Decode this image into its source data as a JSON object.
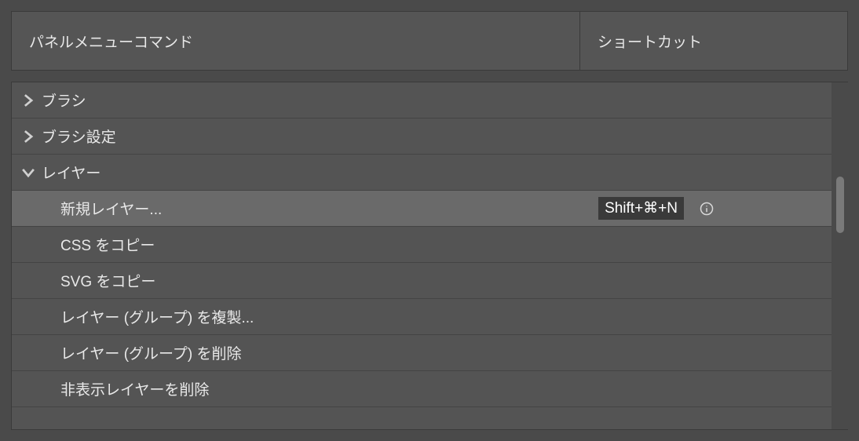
{
  "header": {
    "left_label": "パネルメニューコマンド",
    "right_label": "ショートカット"
  },
  "groups": [
    {
      "label": "ブラシ",
      "expanded": false,
      "children": []
    },
    {
      "label": "ブラシ設定",
      "expanded": false,
      "children": []
    },
    {
      "label": "レイヤー",
      "expanded": true,
      "children": [
        {
          "label": "新規レイヤー...",
          "shortcut": "Shift+⌘+N",
          "selected": true,
          "info": true
        },
        {
          "label": "CSS をコピー",
          "shortcut": "",
          "selected": false,
          "info": false
        },
        {
          "label": "SVG をコピー",
          "shortcut": "",
          "selected": false,
          "info": false
        },
        {
          "label": "レイヤー (グループ) を複製...",
          "shortcut": "",
          "selected": false,
          "info": false
        },
        {
          "label": "レイヤー (グループ) を削除",
          "shortcut": "",
          "selected": false,
          "info": false
        },
        {
          "label": "非表示レイヤーを削除",
          "shortcut": "",
          "selected": false,
          "info": false
        }
      ]
    }
  ]
}
